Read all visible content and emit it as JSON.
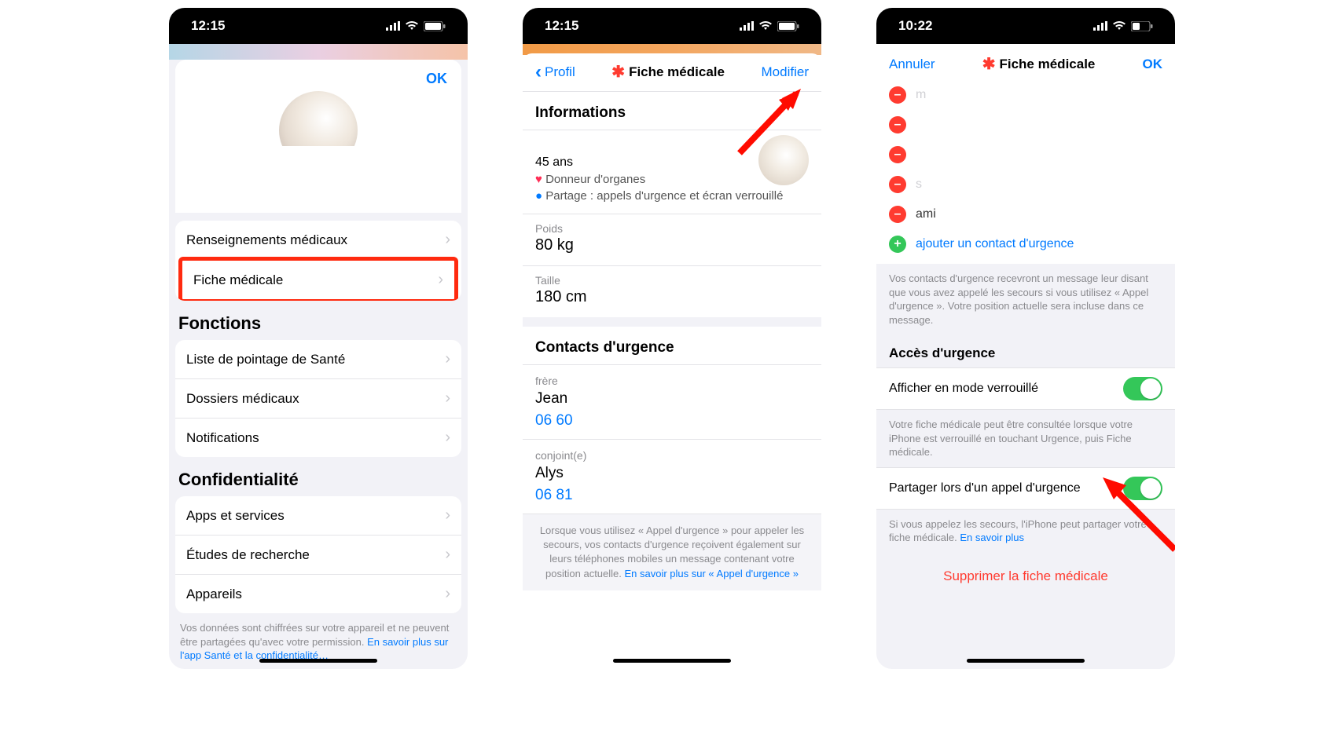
{
  "statusbar": {
    "timeA": "12:15",
    "timeB": "12:15",
    "timeC": "10:22"
  },
  "screen1": {
    "ok": "OK",
    "cell_renseignements": "Renseignements médicaux",
    "cell_fiche": "Fiche médicale",
    "section_fonctions": "Fonctions",
    "cell_liste": "Liste de pointage de Santé",
    "cell_dossiers": "Dossiers médicaux",
    "cell_notifs": "Notifications",
    "section_conf": "Confidentialité",
    "cell_apps": "Apps et services",
    "cell_etudes": "Études de recherche",
    "cell_appareils": "Appareils",
    "footnote_a": "Vos données sont chiffrées sur votre appareil et ne peuvent être partagées qu'avec votre permission. ",
    "footnote_link": "En savoir plus sur l'app Santé et la confidentialité…"
  },
  "screen2": {
    "back": "Profil",
    "title": "Fiche médicale",
    "modify": "Modifier",
    "hdr_info": "Informations",
    "age": "45 ans",
    "donor": " Donneur d'organes",
    "share": " Partage : appels d'urgence et écran verrouillé",
    "label_poids": "Poids",
    "val_poids": "80 kg",
    "label_taille": "Taille",
    "val_taille": "180 cm",
    "hdr_contacts": "Contacts d'urgence",
    "c1_rel": "frère",
    "c1_name": "Jean",
    "c1_phone": "06 60",
    "c2_rel": "conjoint(e)",
    "c2_name": "Alys",
    "c2_phone": "06 81",
    "note": "Lorsque vous utilisez « Appel d'urgence » pour appeler les secours, vos contacts d'urgence reçoivent également sur leurs téléphones mobiles un message contenant votre position actuelle. ",
    "note_link": "En savoir plus sur « Appel d'urgence »"
  },
  "screen3": {
    "cancel": "Annuler",
    "title": "Fiche médicale",
    "ok": "OK",
    "row_m": "m",
    "row_s": "s",
    "row_ami": "ami",
    "add_contact": "ajouter un contact d'urgence",
    "note_contacts": "Vos contacts d'urgence recevront un message leur disant que vous avez appelé les secours si vous utilisez « Appel d'urgence ». Votre position actuelle sera incluse dans ce message.",
    "hdr_access": "Accès d'urgence",
    "toggle1_label": "Afficher en mode verrouillé",
    "note_toggle1": "Votre fiche médicale peut être consultée lorsque votre iPhone est verrouillé en touchant Urgence, puis Fiche médicale.",
    "toggle2_label": "Partager lors d'un appel d'urgence",
    "note_toggle2a": "Si vous appelez les secours, l'iPhone peut partager votre fiche médicale. ",
    "note_toggle2_link": "En savoir plus",
    "delete": "Supprimer la fiche médicale"
  }
}
